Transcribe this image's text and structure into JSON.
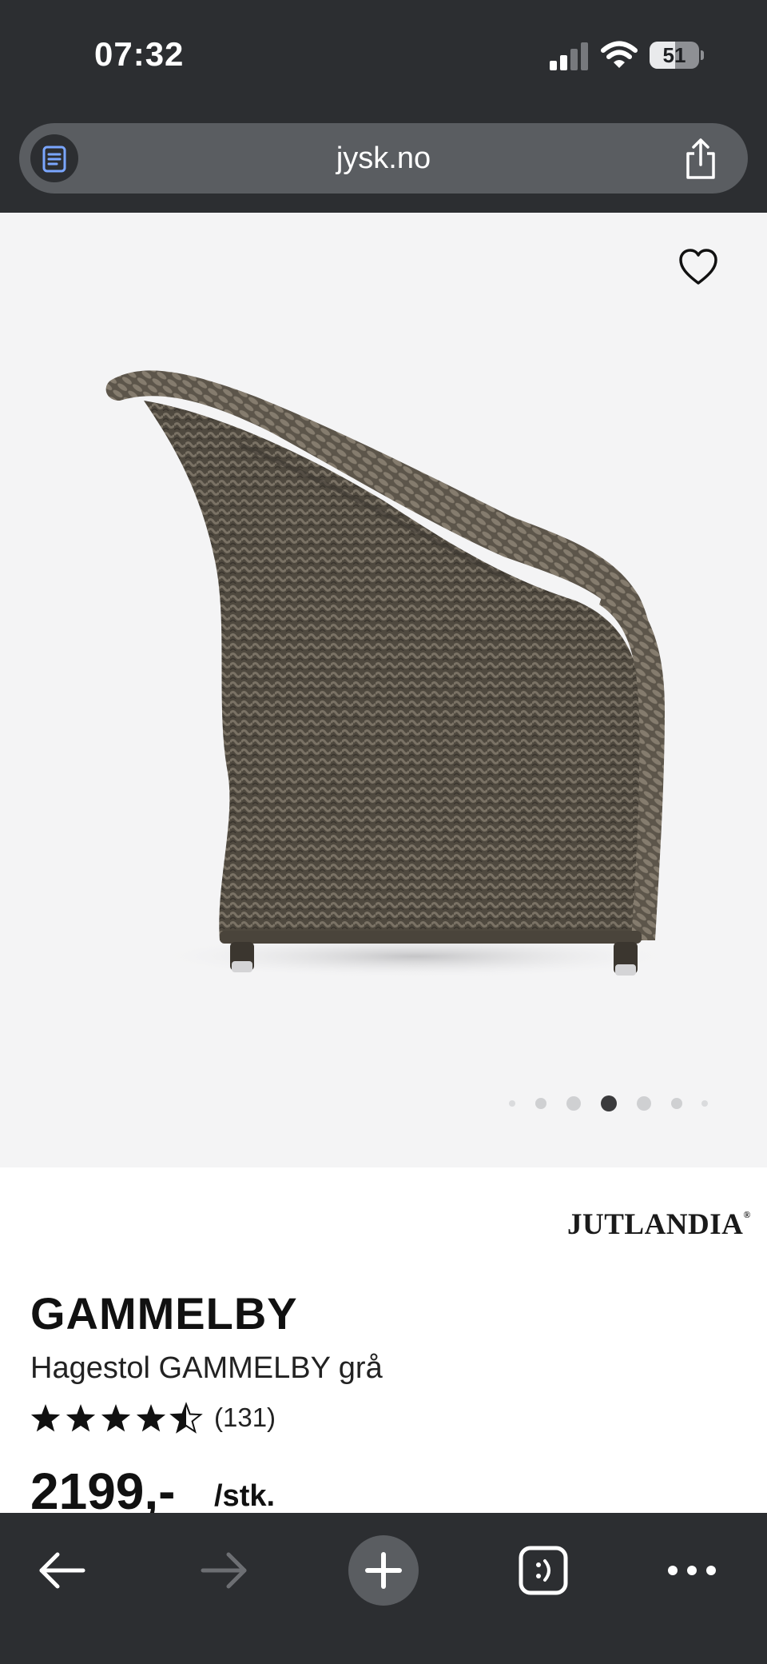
{
  "status_bar": {
    "time": "07:32",
    "battery_level": "51",
    "signal_bars_active": 2,
    "signal_bars_total": 4,
    "icons": [
      "signal-icon",
      "wifi-icon",
      "battery-icon"
    ]
  },
  "browser": {
    "url": "jysk.no",
    "reader_icon": "reader-icon",
    "share_icon": "share-icon"
  },
  "gallery": {
    "image_alt": "Hagestol GAMMELBY grå",
    "favorite_icon": "heart-icon",
    "dot_count": 7,
    "active_dot": 3
  },
  "product": {
    "brand": "JUTLANDIA",
    "brand_mark": "®",
    "name": "GAMMELBY",
    "subtitle": "Hagestol GAMMELBY grå",
    "rating": 4.5,
    "rating_max": 5,
    "rating_count": "(131)",
    "price": "2199,-",
    "unit": "/stk."
  },
  "toolbar": {
    "items": [
      "back-icon",
      "forward-icon",
      "new-tab-icon",
      "tabs-icon",
      "more-icon"
    ],
    "forward_enabled": false
  },
  "colors": {
    "browser_chrome": "#2c2e31",
    "address_bar": "#5a5d61",
    "gallery_bg": "#f4f4f5",
    "text": "#111111",
    "wicker": "#5e574d"
  }
}
